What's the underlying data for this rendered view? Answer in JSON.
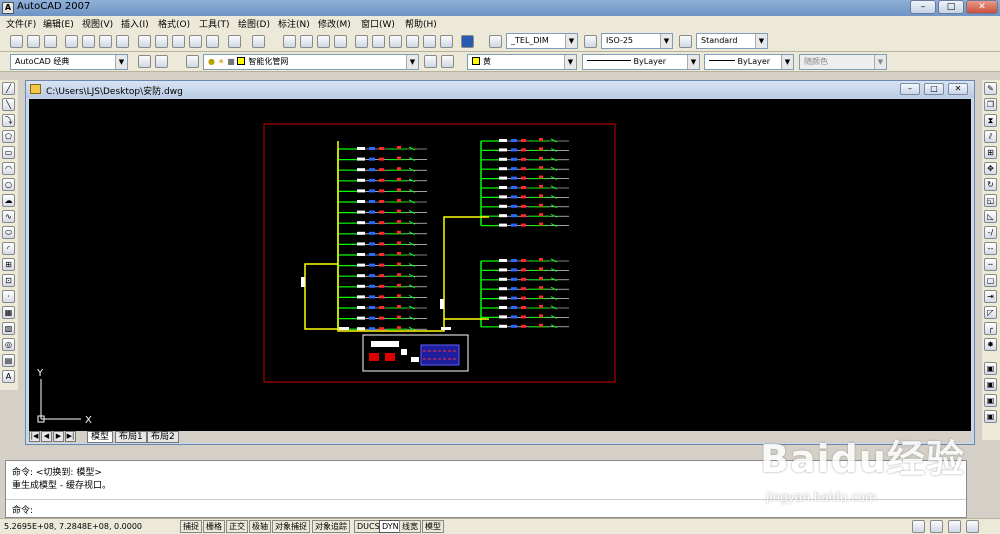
{
  "app": {
    "title": "AutoCAD 2007",
    "icon_text": "A"
  },
  "window_buttons": {
    "minimize": "–",
    "maximize": "□",
    "close": "✕"
  },
  "menu": [
    "文件(F)",
    "编辑(E)",
    "视图(V)",
    "插入(I)",
    "格式(O)",
    "工具(T)",
    "绘图(D)",
    "标注(N)",
    "修改(M)",
    "窗口(W)",
    "帮助(H)"
  ],
  "styles": {
    "text_style": "_TEL_DIM",
    "dim_style": "ISO-25",
    "table_style": "Standard"
  },
  "workspace": "AutoCAD 经典",
  "layer": {
    "name": "智能化管网"
  },
  "properties": {
    "color": "黄",
    "linetype": "ByLayer",
    "lineweight": "ByLayer",
    "plotstyle": "随颜色"
  },
  "drawing": {
    "path": "C:\\Users\\LJS\\Desktop\\安防.dwg"
  },
  "ucs": {
    "y": "Y",
    "x": "X"
  },
  "layout_tabs": [
    {
      "label": "模型",
      "active": true
    },
    {
      "label": "布局1",
      "active": false
    },
    {
      "label": "布局2",
      "active": false
    }
  ],
  "layout_nav": [
    "|◀",
    "◀",
    "▶",
    "▶|"
  ],
  "command_history": [
    "命令: <切换到: 模型>",
    "重生成模型 - 缓存视口。"
  ],
  "command_prompt": "命令:",
  "coordinates": "5.2695E+08, 7.2848E+08, 0.0000",
  "status_toggles": [
    {
      "label": "捕捉",
      "on": false
    },
    {
      "label": "栅格",
      "on": false
    },
    {
      "label": "正交",
      "on": false
    },
    {
      "label": "极轴",
      "on": false
    },
    {
      "label": "对象捕捉",
      "on": false
    },
    {
      "label": "对象追踪",
      "on": false
    },
    {
      "label": "DUCS",
      "on": false
    },
    {
      "label": "DYN",
      "on": true
    },
    {
      "label": "线宽",
      "on": false
    },
    {
      "label": "模型",
      "on": false
    }
  ],
  "watermark": {
    "brand": "Baidu经验",
    "url": "jingyan.baidu.com"
  },
  "colors": {
    "canvas": "#000000",
    "frame": "#cc0000",
    "trunk": "#ffff00",
    "branch": "#00ff00",
    "row_line": "#ffffff"
  }
}
